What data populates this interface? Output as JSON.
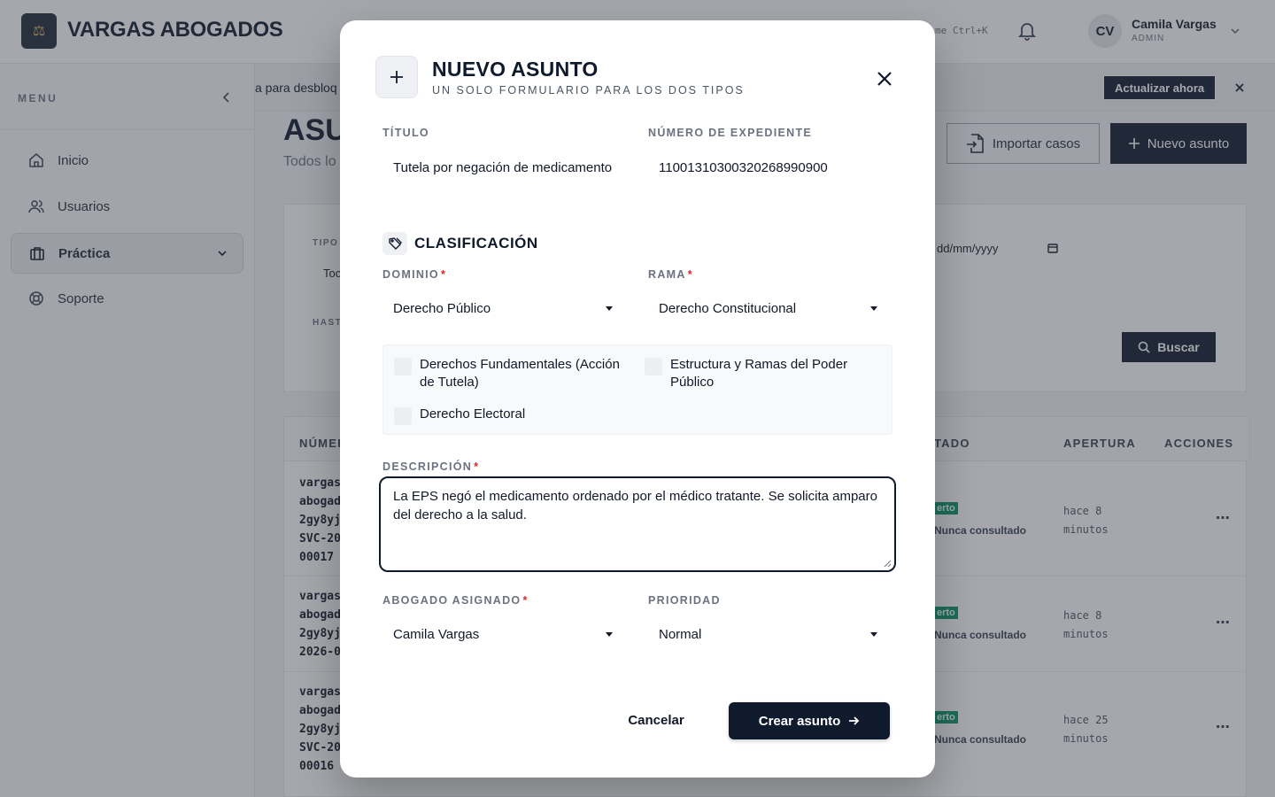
{
  "app": {
    "brand": "VARGAS ABOGADOS",
    "search_hint": "me Ctrl+K",
    "user": {
      "initials": "CV",
      "name": "Camila Vargas",
      "role": "ADMIN"
    }
  },
  "sidebar": {
    "menu_label": "MENU",
    "items": [
      {
        "label": "Inicio"
      },
      {
        "label": "Usuarios"
      },
      {
        "label": "Práctica"
      },
      {
        "label": "Soporte"
      }
    ]
  },
  "banner": {
    "text": "a para desbloq",
    "button": "Actualizar ahora"
  },
  "page": {
    "title": "ASU",
    "subtitle": "Todos lo",
    "import_button": "Importar casos",
    "new_button": "Nuevo asunto"
  },
  "filters": {
    "tipo_label": "TIPO",
    "tipo_value": "Toc",
    "hasta_label": "HAST",
    "date_placeholder": "dd/mm/yyyy",
    "search_button": "Buscar"
  },
  "table": {
    "headers": [
      "NÚMER",
      "TADO",
      "APERTURA",
      "ACCIONES"
    ],
    "rows": [
      {
        "number": "vargas\nabogad\n2gy8yj\nSVC-20\n00017",
        "badge": "erto",
        "status": "Nunca consultado",
        "time": "hace 8\nminutos"
      },
      {
        "number": "vargas\nabogad\n2gy8yj\n2026-0",
        "badge": "erto",
        "status": "Nunca consultado",
        "time": "hace 8\nminutos"
      },
      {
        "number": "vargas\nabogad\n2gy8yj\nSVC-20\n00016",
        "badge": "erto",
        "status": "Nunca consultado",
        "time": "hace 25\nminutos"
      }
    ],
    "actions_glyph": "⋯"
  },
  "modal": {
    "title": "NUEVO ASUNTO",
    "subtitle": "UN SOLO FORMULARIO PARA LOS DOS TIPOS",
    "titulo_label": "TÍTULO",
    "titulo_value": "Tutela por negación de medicamento",
    "expediente_label": "NÚMERO DE EXPEDIENTE",
    "expediente_value": "11001310300320268990900",
    "section_title": "CLASIFICACIÓN",
    "dominio_label": "DOMINIO",
    "dominio_value": "Derecho Público",
    "rama_label": "RAMA",
    "rama_value": "Derecho Constitucional",
    "checkboxes": [
      {
        "label": "Derechos Fundamentales (Acción de Tutela)",
        "checked": false
      },
      {
        "label": "Estructura y Ramas del Poder Público",
        "checked": false
      },
      {
        "label": "Derecho Electoral",
        "checked": false
      }
    ],
    "descripcion_label": "DESCRIPCIÓN",
    "descripcion_value": "La EPS negó el medicamento ordenado por el médico tratante. Se solicita amparo del derecho a la salud.",
    "abogado_label": "ABOGADO ASIGNADO",
    "abogado_value": "Camila Vargas",
    "prioridad_label": "PRIORIDAD",
    "prioridad_value": "Normal",
    "required_mark": "*",
    "cancel_button": "Cancelar",
    "create_button": "Crear asunto"
  },
  "colors": {
    "primary": "#0f1b2d",
    "success": "#059669",
    "required": "#dc2626"
  }
}
